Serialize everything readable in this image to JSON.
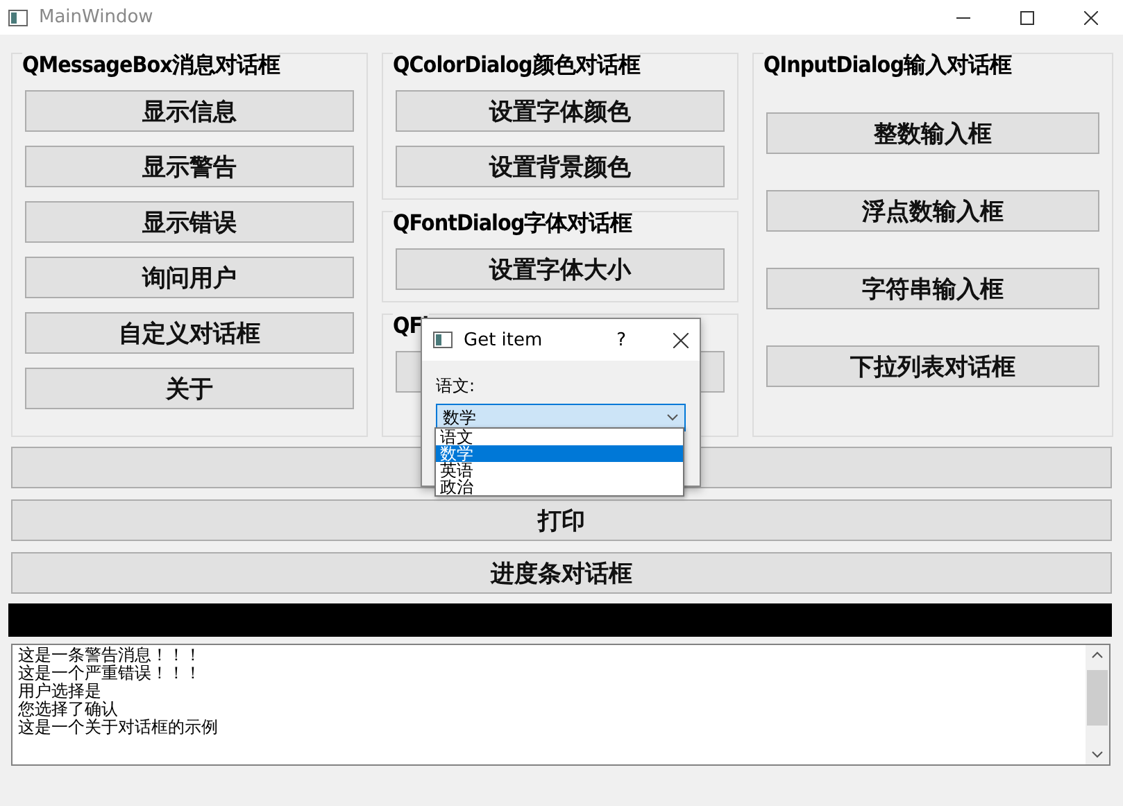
{
  "window": {
    "title": "MainWindow"
  },
  "columns": [
    {
      "groups": [
        {
          "title": "QMessageBox消息对话框",
          "buttons": [
            {
              "kind": "text",
              "label": "显示信息"
            },
            {
              "kind": "text",
              "label": "显示警告"
            },
            {
              "kind": "text",
              "label": "显示错误"
            },
            {
              "kind": "text",
              "label": "询问用户"
            },
            {
              "kind": "text",
              "label": "自定义对话框"
            },
            {
              "kind": "text",
              "label": "关于"
            }
          ]
        }
      ]
    },
    {
      "groups": [
        {
          "title": "QColorDialog颜色对话框",
          "buttons": [
            {
              "kind": "text",
              "label": "设置字体颜色"
            },
            {
              "kind": "text",
              "label": "设置背景颜色"
            }
          ]
        },
        {
          "title": "QFontDialog字体对话框",
          "buttons": [
            {
              "kind": "text",
              "label": "设置字体大小"
            }
          ]
        },
        {
          "title": "QFi",
          "buttons": [
            {
              "kind": "blank"
            }
          ]
        }
      ]
    },
    {
      "groups": [
        {
          "title": "QInputDialog输入对话框",
          "buttons": [
            {
              "kind": "text",
              "label": "整数输入框"
            },
            {
              "kind": "text",
              "label": "浮点数输入框"
            },
            {
              "kind": "text",
              "label": "字符串输入框"
            },
            {
              "kind": "text",
              "label": "下拉列表对话框"
            }
          ]
        }
      ]
    }
  ],
  "wide_buttons": [
    {
      "kind": "blank"
    },
    {
      "kind": "text",
      "label": "打印"
    },
    {
      "kind": "text",
      "label": "进度条对话框"
    }
  ],
  "progress": {
    "level": 1
  },
  "log": {
    "lines": [
      "这是一条警告消息！！！",
      "这是一个严重错误！！！",
      "用户选择是",
      "您选择了确认",
      "这是一个关于对话框的示例"
    ]
  },
  "dialog": {
    "title": "Get item",
    "help": "?",
    "label": "语文:",
    "value": "数学",
    "options": [
      {
        "text": "语文",
        "selected": false
      },
      {
        "text": "数学",
        "selected": true
      },
      {
        "text": "英语",
        "selected": false
      },
      {
        "text": "政治",
        "selected": false
      }
    ]
  }
}
